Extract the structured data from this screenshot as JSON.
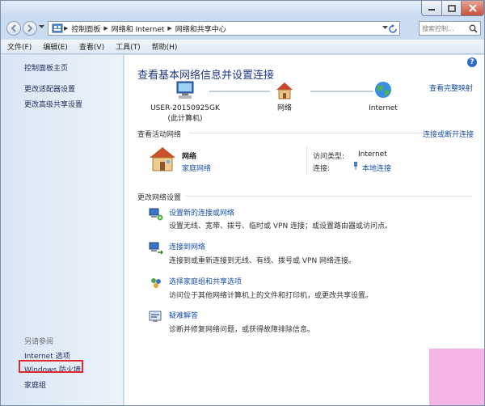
{
  "address": {
    "segments": [
      "控制面板",
      "网络和 Internet",
      "网络和共享中心"
    ]
  },
  "search": {
    "placeholder": "搜索控制..."
  },
  "menu": [
    "文件(F)",
    "编辑(E)",
    "查看(V)",
    "工具(T)",
    "帮助(H)"
  ],
  "sidebar": {
    "top_links": [
      "控制面板主页",
      "更改适配器设置",
      "更改高级共享设置"
    ],
    "see_also_title": "另请参阅",
    "bottom_links": [
      "Internet 选项",
      "Windows 防火墙",
      "家庭组"
    ]
  },
  "main": {
    "title": "查看基本网络信息并设置连接",
    "full_map_link": "查看完整映射",
    "nodes": [
      {
        "label": "USER-20150925GK",
        "sublabel": "(此计算机)",
        "icon": "computer-icon"
      },
      {
        "label": "网络",
        "sublabel": "",
        "icon": "house-icon"
      },
      {
        "label": "Internet",
        "sublabel": "",
        "icon": "globe-icon"
      }
    ],
    "active_section": {
      "title": "查看活动网络",
      "connect_link": "连接或断开连接",
      "network_name": "网络",
      "network_type": "家庭网络",
      "access_label": "访问类型:",
      "access_value": "Internet",
      "conn_label": "连接:",
      "conn_value": "本地连接"
    },
    "change_section": {
      "title": "更改网络设置",
      "tasks": [
        {
          "title": "设置新的连接或网络",
          "desc": "设置无线、宽带、拨号、临时或 VPN 连接；或设置路由器或访问点。",
          "icon": "new-connection-icon"
        },
        {
          "title": "连接到网络",
          "desc": "连接到或重新连接到无线、有线、拨号或 VPN 网络连接。",
          "icon": "connect-network-icon"
        },
        {
          "title": "选择家庭组和共享选项",
          "desc": "访问位于其他网络计算机上的文件和打印机，或更改共享设置。",
          "icon": "homegroup-icon"
        },
        {
          "title": "疑难解答",
          "desc": "诊断并修复网络问题，或获得故障排除信息。",
          "icon": "troubleshoot-icon"
        }
      ]
    }
  },
  "colors": {
    "link": "#1a4fa6",
    "title": "#1e3a83",
    "highlight": "#e0282f"
  }
}
